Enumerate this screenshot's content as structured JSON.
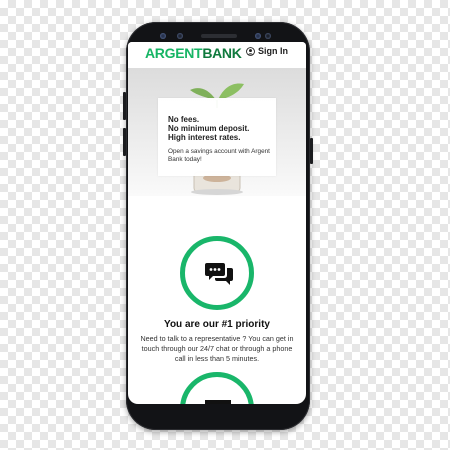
{
  "header": {
    "logo_part1": "ARGENT",
    "logo_part2": "BANK",
    "signin_label": "Sign In"
  },
  "hero": {
    "headline": [
      "No fees.",
      "No minimum deposit.",
      "High interest rates."
    ],
    "subtext": "Open a savings account with Argent Bank today!"
  },
  "features": [
    {
      "icon": "chat-icon",
      "title": "You are our #1 priority",
      "body": "Need to talk to a representative ? You can get in touch through our 24/7 chat or through a phone call in less than 5 minutes."
    },
    {
      "icon": "money-icon"
    }
  ],
  "colors": {
    "brand_green": "#19b66a",
    "logo_dark_green": "#0f7a3d",
    "phone_body": "#121316"
  }
}
